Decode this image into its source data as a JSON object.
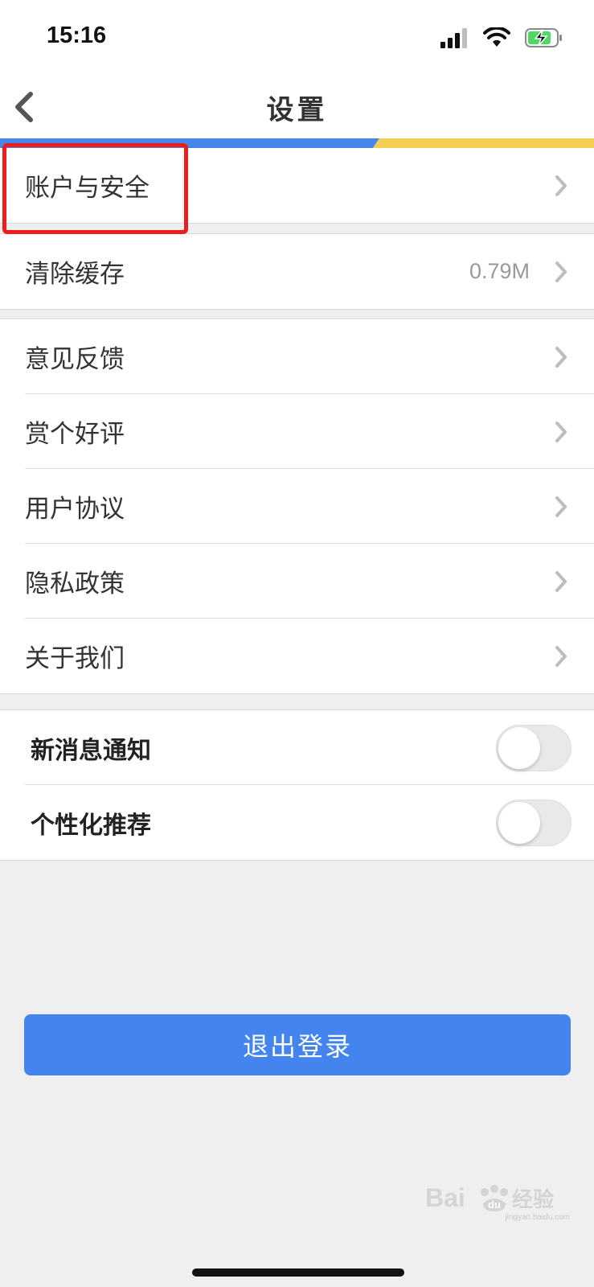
{
  "status_bar": {
    "time": "15:16",
    "icons": [
      "signal-icon",
      "wifi-icon",
      "battery-charging-icon"
    ]
  },
  "nav": {
    "title": "设置",
    "back_icon": "chevron-left-icon",
    "accent_colors": [
      "#4a86e8",
      "#f3cf55"
    ]
  },
  "groups": {
    "account": {
      "label": "账户与安全"
    },
    "cache": {
      "label": "清除缓存",
      "value": "0.79M"
    },
    "info": {
      "items": [
        {
          "label": "意见反馈"
        },
        {
          "label": "赏个好评"
        },
        {
          "label": "用户协议"
        },
        {
          "label": "隐私政策"
        },
        {
          "label": "关于我们"
        }
      ]
    },
    "toggles": {
      "items": [
        {
          "label": "新消息通知",
          "enabled": false
        },
        {
          "label": "个性化推荐",
          "enabled": false
        }
      ]
    }
  },
  "logout": {
    "label": "退出登录",
    "color": "#4384ee"
  },
  "highlight_color": "#ee1c1c",
  "watermark": {
    "brand": "Bai du 经验",
    "url": "jingyan.baidu.com"
  }
}
